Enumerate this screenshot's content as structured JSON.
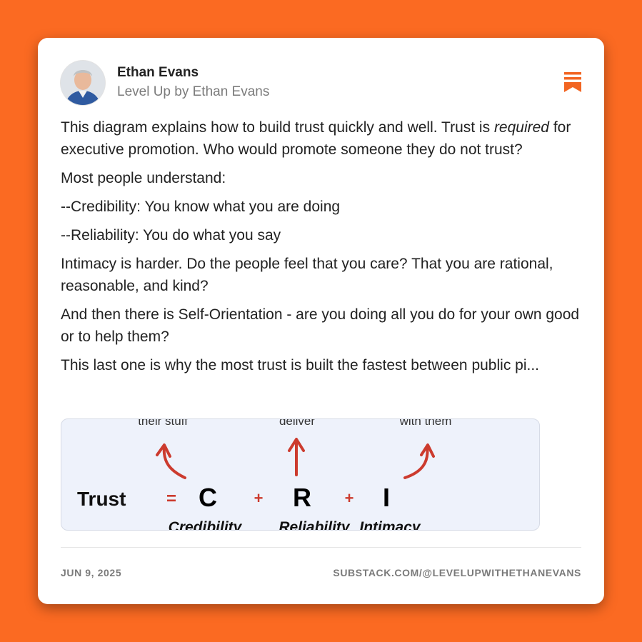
{
  "colors": {
    "background": "#fb6a22",
    "accent": "#f26522",
    "arrow": "#cc3b2e"
  },
  "header": {
    "author": "Ethan Evans",
    "publication": "Level Up by Ethan Evans",
    "avatar_icon": "person-avatar",
    "bookmark_icon": "bookmark-icon"
  },
  "post": {
    "paragraphs": [
      "This diagram explains how to build trust quickly and well. Trust is ",
      "Most people understand:",
      "--Credibility: You know what you are doing",
      "--Reliability: You do what you say",
      "Intimacy is harder. Do the people feel that you care? That you are rational, reasonable, and kind?",
      "And then there is Self-Orientation - are you doing all you do for your own good or to help them?",
      "This last one is why the most trust is built the fastest between"
    ],
    "p1_emphasis": "required",
    "p1_rest": " for executive promotion. Who would promote someone they do not trust?",
    "p7_cut": "public pi..."
  },
  "figure": {
    "top_labels": [
      "their stuff",
      "deliver",
      "with them"
    ],
    "word": "Trust",
    "equals": "=",
    "plus": "+",
    "letters": [
      "C",
      "R",
      "I"
    ],
    "names": [
      "Credibility",
      "Reliability",
      "Intimacy"
    ]
  },
  "footer": {
    "date": "JUN 9, 2025",
    "url": "SUBSTACK.COM/@LEVELUPWITHETHANEVANS"
  }
}
